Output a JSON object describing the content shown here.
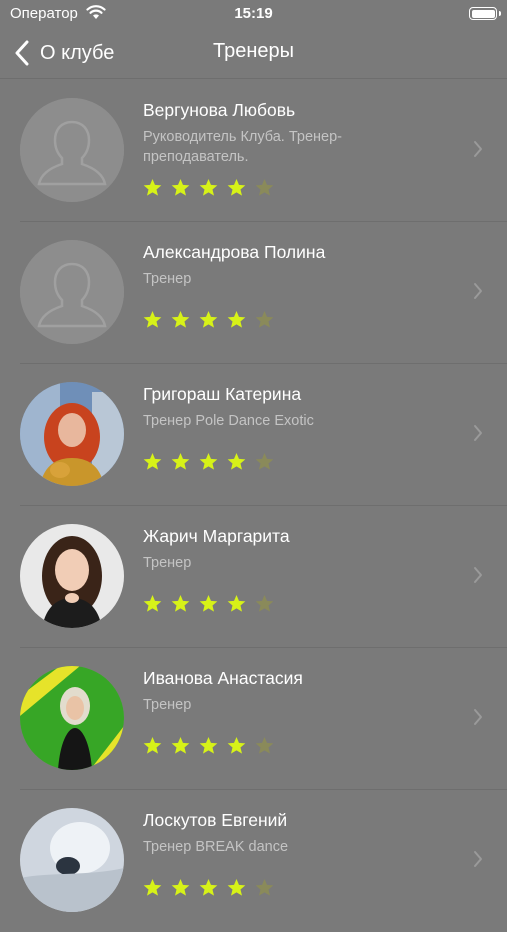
{
  "status_bar": {
    "carrier": "Оператор",
    "time": "15:19"
  },
  "nav": {
    "back_label": "О клубе",
    "title": "Тренеры"
  },
  "colors": {
    "star_on": "#d7f218",
    "star_off": "#8a8a5a",
    "background": "#7a7a7a"
  },
  "trainers": [
    {
      "name": "Вергунова Любовь",
      "role": "Руководитель Клуба. Тренер-преподаватель.",
      "rating": 4,
      "max_rating": 5,
      "avatar": "placeholder"
    },
    {
      "name": "Александрова Полина",
      "role": "Тренер",
      "rating": 4,
      "max_rating": 5,
      "avatar": "placeholder"
    },
    {
      "name": "Григораш Катерина",
      "role": "Тренер Pole Dance Exotic",
      "rating": 4,
      "max_rating": 5,
      "avatar": "photo"
    },
    {
      "name": "Жарич Маргарита",
      "role": "Тренер",
      "rating": 4,
      "max_rating": 5,
      "avatar": "photo"
    },
    {
      "name": "Иванова Анастасия",
      "role": "Тренер",
      "rating": 4,
      "max_rating": 5,
      "avatar": "photo"
    },
    {
      "name": "Лоскутов Евгений",
      "role": "Тренер BREAK dance",
      "rating": 4,
      "max_rating": 5,
      "avatar": "photo"
    }
  ]
}
